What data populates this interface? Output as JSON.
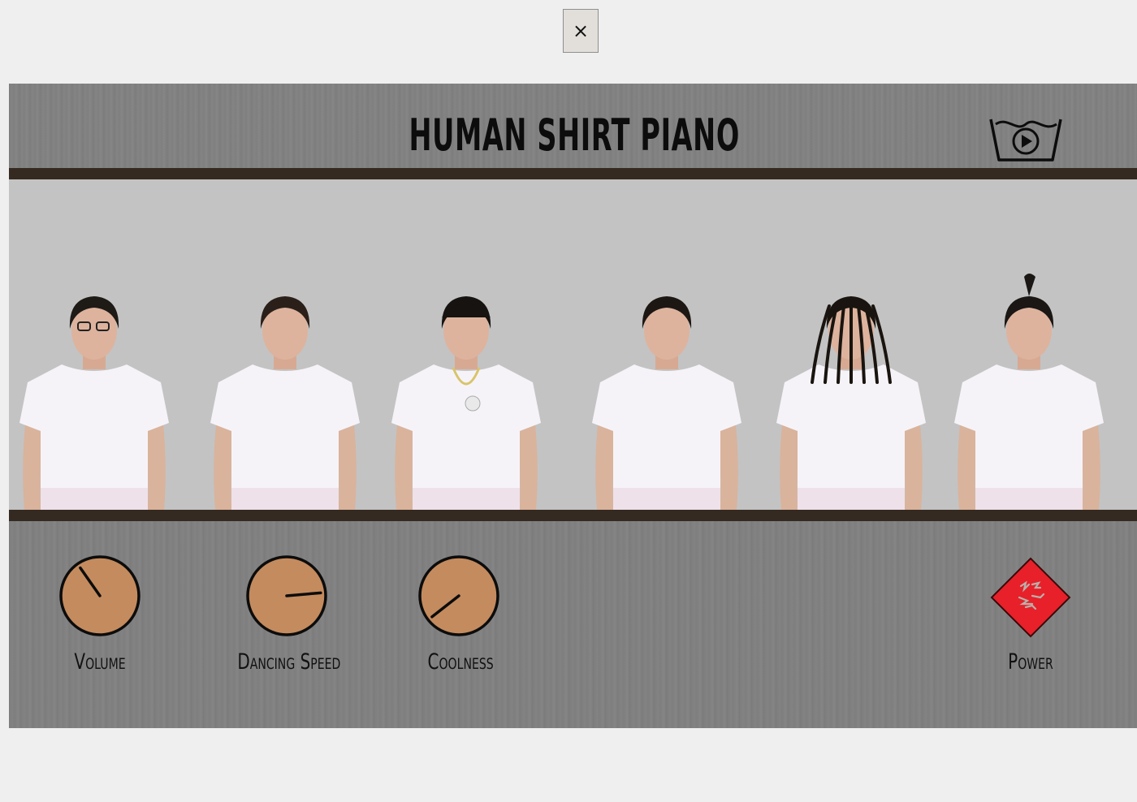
{
  "close_button": {
    "glyph": "×"
  },
  "app": {
    "title": "HUMAN SHIRT PIANO",
    "header_icon": "wash-symbol-play-icon",
    "colors": {
      "panel": "#808080",
      "rail": "#342a21",
      "stage": "#c3c3c3",
      "knob": "#c48b5e",
      "power": "#e8202a"
    }
  },
  "performers": [
    {
      "name": "performer-1",
      "hair": "#1e1a16",
      "accessory": "glasses"
    },
    {
      "name": "performer-2",
      "hair": "#2a2019",
      "accessory": "none"
    },
    {
      "name": "performer-3",
      "hair": "#161311",
      "accessory": "cap-and-chain"
    },
    {
      "name": "performer-4",
      "hair": "#1d1714",
      "accessory": "none"
    },
    {
      "name": "performer-5",
      "hair": "#19140f",
      "accessory": "dreadlocks"
    },
    {
      "name": "performer-6",
      "hair": "#1a1714",
      "accessory": "topknot"
    }
  ],
  "controls": {
    "volume": {
      "label": "Volume",
      "angle_deg": -35
    },
    "dancing_speed": {
      "label": "Dancing Speed",
      "angle_deg": 85
    },
    "coolness": {
      "label": "Coolness",
      "angle_deg": -128
    },
    "power": {
      "label": "Power",
      "icon": "power-diamond-icon"
    }
  }
}
